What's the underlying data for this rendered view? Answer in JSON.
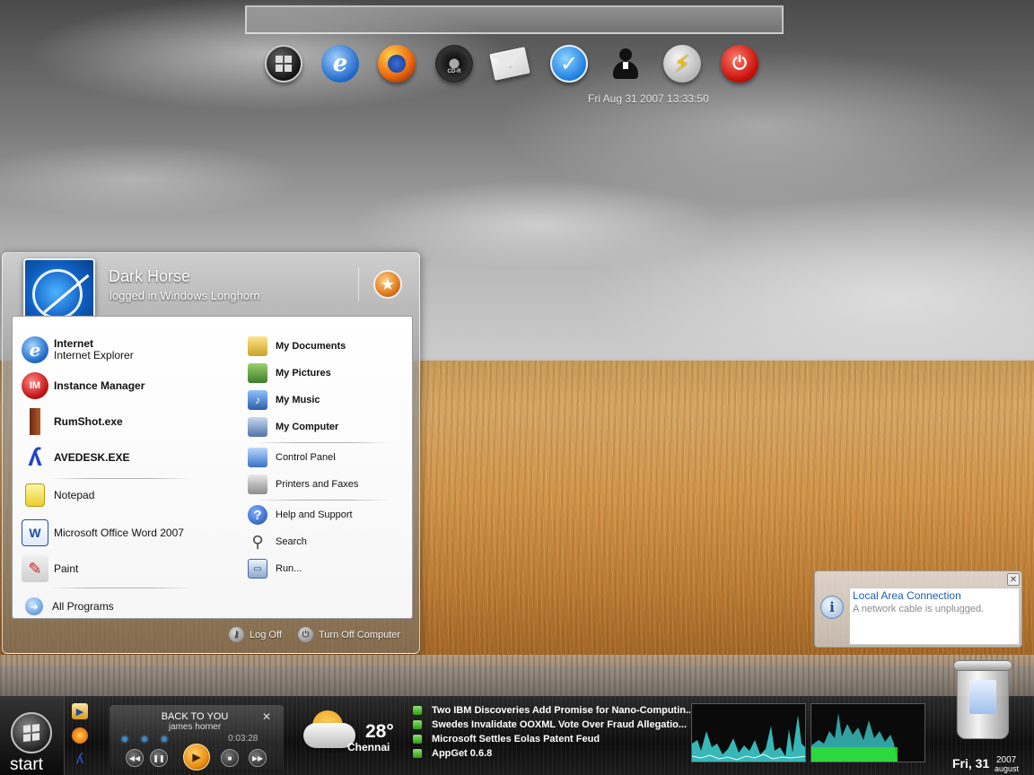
{
  "dock": {
    "icons": [
      "windows-icon",
      "internet-explorer-icon",
      "firefox-icon",
      "cd-icon",
      "mail-icon",
      "checkmark-icon",
      "user-icon",
      "lightning-icon",
      "power-icon"
    ],
    "cd_label": "CD-R",
    "clock": "Fri Aug 31 2007 13:33:50"
  },
  "start_menu": {
    "user_name": "Dark Horse",
    "user_subtitle": "logged in Windows Longhorn",
    "left_items": [
      {
        "label": "Internet",
        "sublabel": "Internet Explorer",
        "icon": "internet-explorer-icon"
      },
      {
        "label": "Instance Manager",
        "icon": "instance-manager-icon"
      },
      {
        "label": "RumShot.exe",
        "icon": "glass-icon"
      },
      {
        "label": "AVEDESK.EXE",
        "icon": "avedesk-icon"
      },
      {
        "label": "Notepad",
        "icon": "notepad-icon"
      },
      {
        "label": "Microsoft Office Word 2007",
        "icon": "word-icon"
      },
      {
        "label": "Paint",
        "icon": "paint-icon"
      }
    ],
    "all_programs": "All Programs",
    "right_items": [
      {
        "label": "My Documents",
        "icon": "folder-icon"
      },
      {
        "label": "My Pictures",
        "icon": "pictures-icon"
      },
      {
        "label": "My Music",
        "icon": "music-icon"
      },
      {
        "label": "My Computer",
        "icon": "computer-icon"
      },
      {
        "label": "Control Panel",
        "icon": "control-panel-icon"
      },
      {
        "label": "Printers and Faxes",
        "icon": "printer-icon"
      },
      {
        "label": "Help and Support",
        "icon": "help-icon"
      },
      {
        "label": "Search",
        "icon": "search-icon"
      },
      {
        "label": "Run...",
        "icon": "run-icon"
      }
    ],
    "log_off": "Log Off",
    "turn_off": "Turn Off Computer"
  },
  "balloon": {
    "title": "Local Area Connection",
    "message": "A network cable is unplugged."
  },
  "taskbar": {
    "start_label": "start",
    "player": {
      "title": "BACK TO YOU",
      "artist": "james horner",
      "time": "0:03:28"
    },
    "weather": {
      "temperature": "28°",
      "city": "Chennai"
    },
    "news": [
      "Two IBM Discoveries Add Promise for Nano-Computin...",
      "Swedes Invalidate OOXML Vote Over Fraud Allegatio...",
      "Microsoft Settles Eolas Patent Feud",
      "AppGet 0.6.8"
    ],
    "date": {
      "day": "Fri, 31",
      "year": "2007",
      "month": "august"
    }
  },
  "colors": {
    "accent_blue": "#1a5fb4",
    "news_bullet": "#4cbf2a",
    "graph_cyan": "#3fd6d6",
    "graph_green": "#2de22d"
  }
}
